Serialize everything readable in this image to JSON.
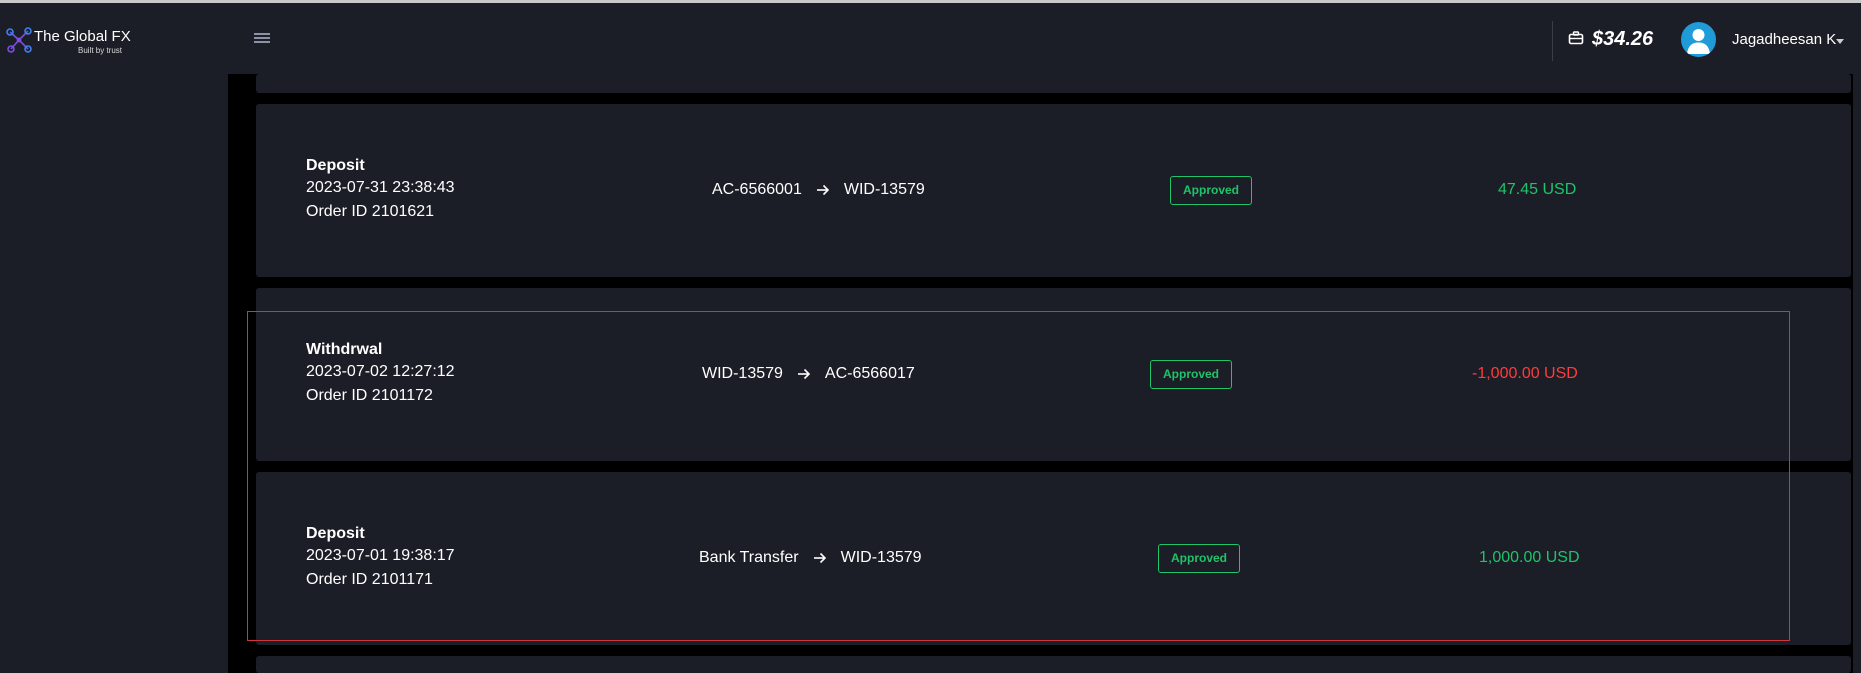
{
  "brand": {
    "name": "The Global FX",
    "tagline": "Built by trust",
    "accent": "#7b4fe0"
  },
  "header": {
    "menu_icon": "hamburger-icon",
    "wallet_icon": "briefcase-icon",
    "balance": "$34.26",
    "user_name": "Jagadheesan K",
    "avatar_icon": "user-avatar-icon",
    "caret_icon": "caret-down-icon"
  },
  "colors": {
    "approved": "#1fc36a",
    "positive_amount": "#1fc36a",
    "negative_amount": "#ff3b3b",
    "highlight_border": "#d0343c",
    "card_bg": "#1b1e26"
  },
  "transactions": [
    {
      "type": "Deposit",
      "datetime": "2023-07-31 23:38:43",
      "order_id": "Order ID 2101621",
      "from": "AC-6566001",
      "to": "WID-13579",
      "status": "Approved",
      "amount": "47.45 USD",
      "direction": "credit"
    },
    {
      "type": "Withdrwal",
      "datetime": "2023-07-02 12:27:12",
      "order_id": "Order ID 2101172",
      "from": "WID-13579",
      "to": "AC-6566017",
      "status": "Approved",
      "amount": "-1,000.00 USD",
      "direction": "debit"
    },
    {
      "type": "Deposit",
      "datetime": "2023-07-01 19:38:17",
      "order_id": "Order ID 2101171",
      "from": "Bank Transfer",
      "to": "WID-13579",
      "status": "Approved",
      "amount": "1,000.00 USD",
      "direction": "credit"
    }
  ]
}
